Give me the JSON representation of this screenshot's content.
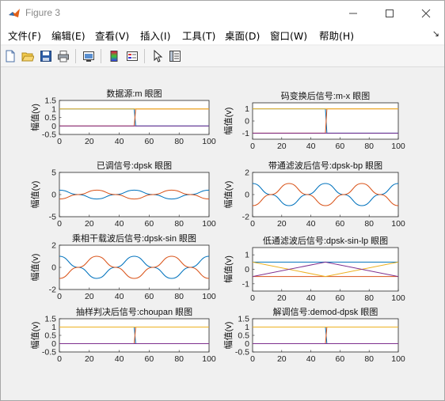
{
  "window": {
    "title": "Figure 3"
  },
  "menu": [
    "文件(F)",
    "编辑(E)",
    "查看(V)",
    "插入(I)",
    "工具(T)",
    "桌面(D)",
    "窗口(W)",
    "帮助(H)"
  ],
  "toolbar": {
    "icons": [
      "new-figure-icon",
      "open-file-icon",
      "save-icon",
      "print-icon",
      "link-plot-icon",
      "insert-colorbar-icon",
      "insert-legend-icon",
      "edit-plot-arrow-icon",
      "property-inspector-icon"
    ]
  },
  "colors": {
    "blue": "#0072BD",
    "orange": "#D95319",
    "yellow": "#EDB120",
    "purple": "#7E2F8E",
    "green": "#77AC30"
  },
  "chart_data": [
    {
      "type": "line",
      "title": "数据源:m 眼图",
      "ylabel": "幅值(v)",
      "xlim": [
        0,
        100
      ],
      "ylim": [
        -0.5,
        1.5
      ],
      "xticks": [
        0,
        20,
        40,
        60,
        80,
        100
      ],
      "yticks": [
        -0.5,
        0,
        0.5,
        1,
        1.5
      ],
      "series": [
        {
          "x": [
            0,
            50,
            51,
            100
          ],
          "y": [
            1,
            1,
            0,
            0
          ]
        },
        {
          "x": [
            0,
            50,
            51,
            100
          ],
          "y": [
            0,
            0,
            1,
            1
          ]
        },
        {
          "x": [
            0,
            100
          ],
          "y": [
            1,
            1
          ]
        },
        {
          "x": [
            0,
            100
          ],
          "y": [
            0,
            0
          ]
        }
      ]
    },
    {
      "type": "line",
      "title": "码变换后信号:m-x 眼图",
      "ylabel": "幅值(v)",
      "xlim": [
        0,
        100
      ],
      "ylim": [
        -1.5,
        1.5
      ],
      "xticks": [
        0,
        20,
        40,
        60,
        80,
        100
      ],
      "yticks": [
        -1,
        0,
        1
      ],
      "series": [
        {
          "x": [
            0,
            50,
            51,
            100
          ],
          "y": [
            1,
            1,
            -1,
            -1
          ]
        },
        {
          "x": [
            0,
            50,
            51,
            100
          ],
          "y": [
            -1,
            -1,
            1,
            1
          ]
        },
        {
          "x": [
            0,
            100
          ],
          "y": [
            1,
            1
          ]
        },
        {
          "x": [
            0,
            100
          ],
          "y": [
            -1,
            -1
          ]
        }
      ]
    },
    {
      "type": "line",
      "title": "已调信号:dpsk 眼图",
      "ylabel": "幅值(v)",
      "xlim": [
        0,
        100
      ],
      "ylim": [
        -5,
        5
      ],
      "xticks": [
        0,
        20,
        40,
        60,
        80,
        100
      ],
      "yticks": [
        -5,
        0,
        5
      ],
      "series": [
        {
          "x": [
            0,
            12.5,
            25,
            37.5,
            50,
            62.5,
            75,
            87.5,
            100
          ],
          "y": [
            1,
            0,
            -1,
            0,
            1,
            0,
            -1,
            0,
            1
          ]
        },
        {
          "x": [
            0,
            12.5,
            25,
            37.5,
            50,
            62.5,
            75,
            87.5,
            100
          ],
          "y": [
            -1,
            0,
            1,
            0,
            -1,
            0,
            1,
            0,
            -1
          ]
        }
      ]
    },
    {
      "type": "line",
      "title": "带通滤波后信号:dpsk-bp 眼图",
      "ylabel": "幅值(v)",
      "xlim": [
        0,
        100
      ],
      "ylim": [
        -2,
        2
      ],
      "xticks": [
        0,
        20,
        40,
        60,
        80,
        100
      ],
      "yticks": [
        -2,
        0,
        2
      ],
      "series": [
        {
          "x": [
            0,
            12.5,
            25,
            37.5,
            50,
            62.5,
            75,
            87.5,
            100
          ],
          "y": [
            1,
            0,
            -1,
            0,
            1,
            0,
            -1,
            0,
            1
          ]
        },
        {
          "x": [
            0,
            12.5,
            25,
            37.5,
            50,
            62.5,
            75,
            87.5,
            100
          ],
          "y": [
            -1,
            0,
            1,
            0,
            -1,
            0,
            1,
            0,
            -1
          ]
        }
      ]
    },
    {
      "type": "line",
      "title": "乘相干载波后信号:dpsk-sin 眼图",
      "ylabel": "幅值(v)",
      "xlim": [
        0,
        100
      ],
      "ylim": [
        -2,
        2
      ],
      "xticks": [
        0,
        20,
        40,
        60,
        80,
        100
      ],
      "yticks": [
        -2,
        0,
        2
      ],
      "series": [
        {
          "x": [
            0,
            12.5,
            25,
            37.5,
            50,
            62.5,
            75,
            87.5,
            100
          ],
          "y": [
            1,
            0,
            -1,
            0,
            1,
            0,
            -1,
            0,
            1
          ]
        },
        {
          "x": [
            0,
            12.5,
            25,
            37.5,
            50,
            62.5,
            75,
            87.5,
            100
          ],
          "y": [
            -1,
            0,
            1,
            0,
            -1,
            0,
            1,
            0,
            -1
          ]
        }
      ]
    },
    {
      "type": "line",
      "title": "低通滤波后信号:dpsk-sin-lp 眼图",
      "ylabel": "幅值(v)",
      "xlim": [
        0,
        100
      ],
      "ylim": [
        -1.5,
        1.5
      ],
      "xticks": [
        0,
        20,
        40,
        60,
        80,
        100
      ],
      "yticks": [
        -1,
        0,
        1
      ],
      "series": [
        {
          "x": [
            0,
            50,
            100
          ],
          "y": [
            0.5,
            0.5,
            0.5
          ]
        },
        {
          "x": [
            0,
            50,
            100
          ],
          "y": [
            -0.5,
            -0.5,
            -0.5
          ]
        },
        {
          "x": [
            0,
            50,
            100
          ],
          "y": [
            0.5,
            -0.5,
            0.5
          ]
        },
        {
          "x": [
            0,
            50,
            100
          ],
          "y": [
            -0.5,
            0.5,
            -0.5
          ]
        }
      ]
    },
    {
      "type": "line",
      "title": "抽样判决后信号:choupan 眼图",
      "ylabel": "幅值(v)",
      "xlim": [
        0,
        100
      ],
      "ylim": [
        -0.5,
        1.5
      ],
      "xticks": [
        0,
        20,
        40,
        60,
        80,
        100
      ],
      "yticks": [
        -0.5,
        0,
        0.5,
        1,
        1.5
      ],
      "series": [
        {
          "x": [
            0,
            50,
            51,
            100
          ],
          "y": [
            1,
            1,
            0,
            0
          ]
        },
        {
          "x": [
            0,
            50,
            51,
            100
          ],
          "y": [
            0,
            0,
            1,
            1
          ]
        },
        {
          "x": [
            0,
            100
          ],
          "y": [
            1,
            1
          ]
        },
        {
          "x": [
            0,
            100
          ],
          "y": [
            0,
            0
          ]
        }
      ]
    },
    {
      "type": "line",
      "title": "解调信号:demod-dpsk 眼图",
      "ylabel": "幅值(v)",
      "xlim": [
        0,
        100
      ],
      "ylim": [
        -0.5,
        1.5
      ],
      "xticks": [
        0,
        20,
        40,
        60,
        80,
        100
      ],
      "yticks": [
        -0.5,
        0,
        0.5,
        1,
        1.5
      ],
      "series": [
        {
          "x": [
            0,
            50,
            51,
            100
          ],
          "y": [
            1,
            1,
            0,
            0
          ]
        },
        {
          "x": [
            0,
            50,
            51,
            100
          ],
          "y": [
            0,
            0,
            1,
            1
          ]
        },
        {
          "x": [
            0,
            100
          ],
          "y": [
            1,
            1
          ]
        },
        {
          "x": [
            0,
            100
          ],
          "y": [
            0,
            0
          ]
        }
      ]
    }
  ]
}
